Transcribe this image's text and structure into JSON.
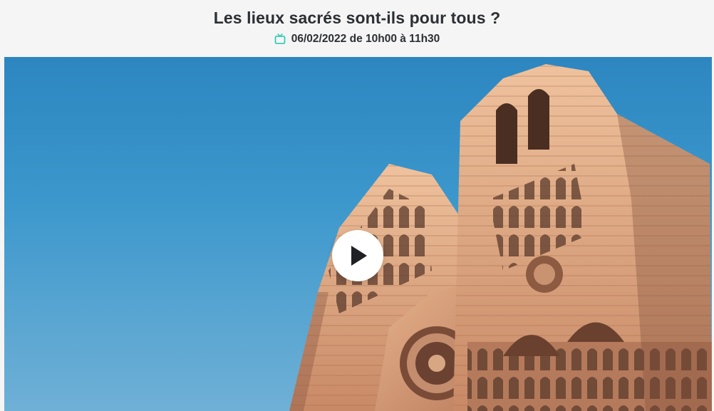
{
  "header": {
    "title": "Les lieux sacrés sont-ils pour tous ?",
    "broadcast": "06/02/2022 de 10h00 à 11h30",
    "broadcast_icon": "tv-icon"
  },
  "player": {
    "thumbnail": "notre-dame-cathedral-facade",
    "play_icon": "play-icon"
  },
  "colors": {
    "accent": "#1fc8b0",
    "text": "#2c2f33",
    "sky": "#3b97cc",
    "stone": "#d9a07a"
  }
}
